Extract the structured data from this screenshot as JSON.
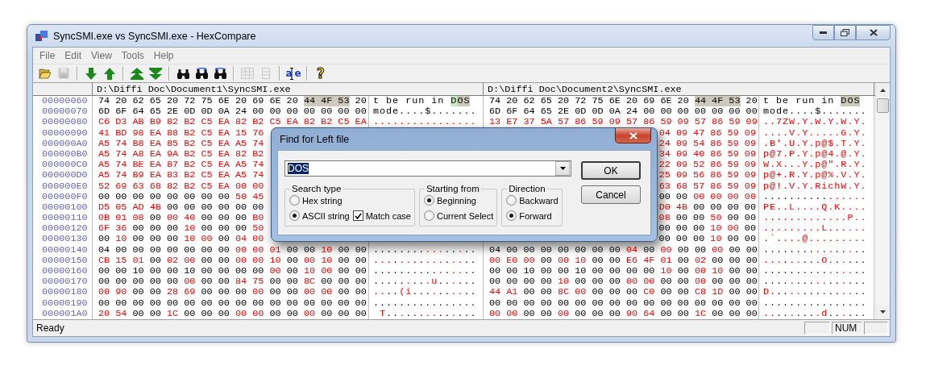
{
  "window": {
    "title": "SyncSMI.exe vs SyncSMI.exe - HexCompare"
  },
  "menu": [
    {
      "label": "File"
    },
    {
      "label": "Edit"
    },
    {
      "label": "View"
    },
    {
      "label": "Tools"
    },
    {
      "label": "Help"
    }
  ],
  "toolbar": [
    {
      "kind": "open",
      "disabled": false
    },
    {
      "kind": "save",
      "disabled": true
    },
    {
      "kind": "separator"
    },
    {
      "kind": "down",
      "disabled": false
    },
    {
      "kind": "up",
      "disabled": false
    },
    {
      "kind": "separator"
    },
    {
      "kind": "first",
      "disabled": false
    },
    {
      "kind": "last",
      "disabled": false
    },
    {
      "kind": "separator"
    },
    {
      "kind": "find",
      "disabled": false
    },
    {
      "kind": "find-next",
      "disabled": false
    },
    {
      "kind": "find-prev",
      "disabled": false
    },
    {
      "kind": "separator"
    },
    {
      "kind": "grid",
      "disabled": true
    },
    {
      "kind": "column",
      "disabled": true
    },
    {
      "kind": "separator"
    },
    {
      "kind": "text-mode",
      "label": "ae",
      "disabled": false
    },
    {
      "kind": "separator"
    },
    {
      "kind": "help",
      "label": "?",
      "disabled": false
    }
  ],
  "left_file": {
    "path": "D:\\Diffi Doc\\Document1\\SyncSMI.exe"
  },
  "right_file": {
    "path": "D:\\Diffi Doc\\Document2\\SyncSMI.exe"
  },
  "rows": [
    {
      "address": "00000060",
      "left_hex": [
        {
          "text": "74 20 62 65 20 72 75 6E 20 69 6E 20",
          "kind": "same"
        },
        {
          "text": "44 4F 53",
          "kind": "found"
        },
        {
          "text": "20",
          "kind": "same"
        }
      ],
      "left_ascii": [
        {
          "text": "t be run in ",
          "kind": "same"
        },
        {
          "text": "D",
          "kind": "cursor"
        },
        {
          "text": "OS",
          "kind": "found"
        }
      ],
      "right_hex": [
        {
          "text": "74 20 62 65 20 72 75 6E 20 69 6E 20",
          "kind": "same"
        },
        {
          "text": "44 4F 53",
          "kind": "found"
        },
        {
          "text": "20",
          "kind": "same"
        }
      ],
      "right_ascii": [
        {
          "text": "t be run in ",
          "kind": "same"
        },
        {
          "text": "DOS",
          "kind": "found"
        }
      ]
    },
    {
      "address": "00000070",
      "left_hex": [
        {
          "text": "6D 6F 64 65 2E 0D 0D 0A 24 00 00 00 00 00 00 00",
          "kind": "same"
        }
      ],
      "left_ascii": [
        {
          "text": "mode....$.......",
          "kind": "same"
        }
      ],
      "right_hex": [
        {
          "text": "6D 6F 64 65 2E 0D 0D 0A 24 00 00 00 00 00 00 00",
          "kind": "same"
        }
      ],
      "right_ascii": [
        {
          "text": "mode....$.......",
          "kind": "same"
        }
      ]
    },
    {
      "address": "00000080",
      "left_hex": [
        {
          "text": "C6 D3 AB B9 82 B2 C5 EA 82 B2 C5 EA 82 B2 C5 EA",
          "kind": "diff"
        }
      ],
      "left_ascii": [
        {
          "text": "................",
          "kind": "diff"
        }
      ],
      "right_hex": [
        {
          "text": "13 E7 37 5A 57 86 59 09 57 86 59 09 57 86 59 09",
          "kind": "diff"
        }
      ],
      "right_ascii": [
        {
          "text": "..7ZW.Y.W.Y.W.Y.",
          "kind": "diff"
        }
      ]
    },
    {
      "address": "00000090",
      "left_hex": [
        {
          "text": "41 BD 98 EA 88 B2 C5 EA 15 76",
          "kind": "diff"
        }
      ],
      "right_hex": [
        {
          "text": "04 09 47 86 59 09",
          "kind": "diff"
        }
      ],
      "right_ascii": [
        {
          "text": "....V.Y.....G.Y.",
          "kind": "diff"
        }
      ]
    },
    {
      "address": "000000A0",
      "left_hex": [
        {
          "text": "A5 74 B8 EA 85 B2 C5 EA A5 74",
          "kind": "diff"
        }
      ],
      "right_hex": [
        {
          "text": "24 09 54 86 59 09",
          "kind": "diff"
        }
      ],
      "right_ascii": [
        {
          "text": ".B'.U.Y.p@$.T.Y.",
          "kind": "diff"
        }
      ]
    },
    {
      "address": "000000B0",
      "left_hex": [
        {
          "text": "A5 74 A8 EA 9A B2 C5 EA 82 B2",
          "kind": "diff"
        }
      ],
      "right_hex": [
        {
          "text": "34 09 40 86 59 09",
          "kind": "diff"
        }
      ],
      "right_ascii": [
        {
          "text": "p@7.P.Y.p@4.@.Y.",
          "kind": "diff"
        }
      ]
    },
    {
      "address": "000000C0",
      "left_hex": [
        {
          "text": "A5 74 BE EA 87 B2 C5 EA A5 74",
          "kind": "diff"
        }
      ],
      "right_hex": [
        {
          "text": "22 09 52 86 59 09",
          "kind": "diff"
        }
      ],
      "right_ascii": [
        {
          "text": "W.X...Y.p@\".R.Y.",
          "kind": "diff"
        }
      ]
    },
    {
      "address": "000000D0",
      "left_hex": [
        {
          "text": "A5 74 B9 EA 83 B2 C5 EA A5 74",
          "kind": "diff"
        }
      ],
      "right_hex": [
        {
          "text": "25 09 56 86 59 09",
          "kind": "diff"
        }
      ],
      "right_ascii": [
        {
          "text": "p@+.R.Y.p@%.V.Y.",
          "kind": "diff"
        }
      ]
    },
    {
      "address": "000000E0",
      "left_hex": [
        {
          "text": "52 69 63 68 82 B2 C5 EA 00 00",
          "kind": "diff"
        }
      ],
      "right_hex": [
        {
          "text": "63 68 57 86 59 09",
          "kind": "diff"
        }
      ],
      "right_ascii": [
        {
          "text": "p@!.V.Y.RichW.Y.",
          "kind": "diff"
        }
      ]
    },
    {
      "address": "000000F0",
      "left_hex": [
        {
          "text": "00 00 00 00 00 00 00 00",
          "kind": "same"
        },
        {
          "text": "50 45",
          "kind": "diff"
        }
      ],
      "right_hex": [
        {
          "text": "00 00",
          "kind": "same"
        },
        {
          "text": "00 00 00 00",
          "kind": "diff"
        }
      ],
      "right_ascii": [
        {
          "text": "..........",
          "kind": "same"
        },
        {
          "text": "......",
          "kind": "diff"
        }
      ]
    },
    {
      "address": "00000100",
      "left_hex": [
        {
          "text": "D5 05 AD 4B",
          "kind": "diff"
        },
        {
          "text": "00 00 00 00 00 00",
          "kind": "same"
        }
      ],
      "right_hex": [
        {
          "text": "D0 4B",
          "kind": "diff"
        },
        {
          "text": "00 00 00 00",
          "kind": "same"
        }
      ],
      "right_ascii": [
        {
          "text": "PE..L....Q.K....",
          "kind": "diff"
        }
      ]
    },
    {
      "address": "00000110",
      "left_hex": [
        {
          "text": "0B 01 08",
          "kind": "diff"
        },
        {
          "text": "00",
          "kind": "same"
        },
        {
          "text": "00 40",
          "kind": "diff"
        },
        {
          "text": "00 00 00",
          "kind": "same"
        },
        {
          "text": "B0",
          "kind": "diff"
        }
      ],
      "right_hex": [
        {
          "text": "08",
          "kind": "diff"
        },
        {
          "text": "00 00",
          "kind": "same"
        },
        {
          "text": "50",
          "kind": "diff"
        },
        {
          "text": "00 00",
          "kind": "same"
        }
      ],
      "right_ascii": [
        {
          "text": ".............P..",
          "kind": "diff"
        }
      ]
    },
    {
      "address": "00000120",
      "left_hex": [
        {
          "text": "6F 36",
          "kind": "diff"
        },
        {
          "text": "00 00 00",
          "kind": "same"
        },
        {
          "text": "10",
          "kind": "diff"
        },
        {
          "text": "00 00 00",
          "kind": "same"
        },
        {
          "text": "50",
          "kind": "diff"
        }
      ],
      "right_hex": [
        {
          "text": "00 00 00",
          "kind": "same"
        },
        {
          "text": "10 00",
          "kind": "diff"
        },
        {
          "text": "00",
          "kind": "same"
        }
      ],
      "right_ascii": [
        {
          "text": ".........L......",
          "kind": "diff"
        }
      ]
    },
    {
      "address": "00000130",
      "left_hex": [
        {
          "text": "00",
          "kind": "same"
        },
        {
          "text": "10",
          "kind": "diff"
        },
        {
          "text": "00 00 00",
          "kind": "same"
        },
        {
          "text": "10 00",
          "kind": "diff"
        },
        {
          "text": "00",
          "kind": "same"
        },
        {
          "text": "04 00",
          "kind": "diff"
        }
      ],
      "right_hex": [
        {
          "text": "00 00 00",
          "kind": "same"
        },
        {
          "text": "10",
          "kind": "diff"
        },
        {
          "text": "00 00",
          "kind": "same"
        }
      ],
      "right_ascii": [
        {
          "text": ".`....@.........",
          "kind": "diff"
        }
      ]
    },
    {
      "address": "00000140",
      "left_hex": [
        {
          "text": "04 00 00 00 00 00 00 00",
          "kind": "same"
        },
        {
          "text": "00 00 01",
          "kind": "diff"
        },
        {
          "text": "00 00",
          "kind": "same"
        },
        {
          "text": "10",
          "kind": "diff"
        },
        {
          "text": "00 00",
          "kind": "same"
        }
      ],
      "left_ascii": [
        {
          "text": "........",
          "kind": "same"
        },
        {
          "text": "...",
          "kind": "diff"
        },
        {
          "text": "..",
          "kind": "same"
        },
        {
          "text": ".",
          "kind": "diff"
        },
        {
          "text": "..",
          "kind": "same"
        }
      ],
      "right_hex": [
        {
          "text": "04 00 00 00 00 00 00 00",
          "kind": "same"
        },
        {
          "text": "04",
          "kind": "diff"
        },
        {
          "text": "00",
          "kind": "same"
        },
        {
          "text": "00",
          "kind": "diff"
        },
        {
          "text": "00 00",
          "kind": "same"
        },
        {
          "text": "00",
          "kind": "diff"
        },
        {
          "text": "00 00",
          "kind": "same"
        }
      ],
      "right_ascii": [
        {
          "text": "........",
          "kind": "same"
        },
        {
          "text": ".",
          "kind": "diff"
        },
        {
          "text": ".",
          "kind": "same"
        },
        {
          "text": ".",
          "kind": "diff"
        },
        {
          "text": "..",
          "kind": "same"
        },
        {
          "text": ".",
          "kind": "diff"
        },
        {
          "text": "..",
          "kind": "same"
        }
      ]
    },
    {
      "address": "00000150",
      "left_hex": [
        {
          "text": "CB 15 01",
          "kind": "diff"
        },
        {
          "text": "00",
          "kind": "same"
        },
        {
          "text": "02 00",
          "kind": "diff"
        },
        {
          "text": "00 00",
          "kind": "same"
        },
        {
          "text": "00 00 10",
          "kind": "diff"
        },
        {
          "text": "00",
          "kind": "same"
        },
        {
          "text": "00 10",
          "kind": "diff"
        },
        {
          "text": "00 00",
          "kind": "same"
        }
      ],
      "left_ascii": [
        {
          "text": "...",
          "kind": "diff"
        },
        {
          "text": ".",
          "kind": "same"
        },
        {
          "text": "..",
          "kind": "diff"
        },
        {
          "text": "..",
          "kind": "same"
        },
        {
          "text": "...",
          "kind": "diff"
        },
        {
          "text": ".",
          "kind": "same"
        },
        {
          "text": "..",
          "kind": "diff"
        },
        {
          "text": "..",
          "kind": "same"
        }
      ],
      "right_hex": [
        {
          "text": "00 E0 00",
          "kind": "diff"
        },
        {
          "text": "00",
          "kind": "same"
        },
        {
          "text": "00 10",
          "kind": "diff"
        },
        {
          "text": "00 00",
          "kind": "same"
        },
        {
          "text": "E6 4F 01",
          "kind": "diff"
        },
        {
          "text": "00",
          "kind": "same"
        },
        {
          "text": "02",
          "kind": "diff"
        },
        {
          "text": "00 00 00",
          "kind": "same"
        }
      ],
      "right_ascii": [
        {
          "text": "...",
          "kind": "diff"
        },
        {
          "text": ".",
          "kind": "same"
        },
        {
          "text": "..",
          "kind": "diff"
        },
        {
          "text": "..",
          "kind": "same"
        },
        {
          "text": ".O.",
          "kind": "diff"
        },
        {
          "text": ".",
          "kind": "same"
        },
        {
          "text": ".",
          "kind": "diff"
        },
        {
          "text": "...",
          "kind": "same"
        }
      ]
    },
    {
      "address": "00000160",
      "left_hex": [
        {
          "text": "00 00 10 00 00 10 00 00 00 00",
          "kind": "same"
        },
        {
          "text": "00",
          "kind": "diff"
        },
        {
          "text": "00",
          "kind": "same"
        },
        {
          "text": "10 00",
          "kind": "diff"
        },
        {
          "text": "00 00",
          "kind": "same"
        }
      ],
      "left_ascii": [
        {
          "text": "..........",
          "kind": "same"
        },
        {
          "text": ".",
          "kind": "diff"
        },
        {
          "text": ".",
          "kind": "same"
        },
        {
          "text": "..",
          "kind": "diff"
        },
        {
          "text": "..",
          "kind": "same"
        }
      ],
      "right_hex": [
        {
          "text": "00 00 10 00 00 10 00 00 00 00",
          "kind": "same"
        },
        {
          "text": "10",
          "kind": "diff"
        },
        {
          "text": "00",
          "kind": "same"
        },
        {
          "text": "00 10",
          "kind": "diff"
        },
        {
          "text": "00 00",
          "kind": "same"
        }
      ],
      "right_ascii": [
        {
          "text": "..........",
          "kind": "same"
        },
        {
          "text": ".",
          "kind": "diff"
        },
        {
          "text": ".",
          "kind": "same"
        },
        {
          "text": "..",
          "kind": "diff"
        },
        {
          "text": "..",
          "kind": "same"
        }
      ]
    },
    {
      "address": "00000170",
      "left_hex": [
        {
          "text": "00 00 00 00 00",
          "kind": "same"
        },
        {
          "text": "00",
          "kind": "diff"
        },
        {
          "text": "00 00",
          "kind": "same"
        },
        {
          "text": "84 75",
          "kind": "diff"
        },
        {
          "text": "00 00",
          "kind": "same"
        },
        {
          "text": "8C",
          "kind": "diff"
        },
        {
          "text": "00 00 00",
          "kind": "same"
        }
      ],
      "left_ascii": [
        {
          "text": ".....",
          "kind": "same"
        },
        {
          "text": ".",
          "kind": "diff"
        },
        {
          "text": "..",
          "kind": "same"
        },
        {
          "text": ".u",
          "kind": "diff"
        },
        {
          "text": "..",
          "kind": "same"
        },
        {
          "text": ".",
          "kind": "diff"
        },
        {
          "text": "...",
          "kind": "same"
        }
      ],
      "right_hex": [
        {
          "text": "00 00 00 00",
          "kind": "same"
        },
        {
          "text": "10",
          "kind": "diff"
        },
        {
          "text": "00 00 00",
          "kind": "same"
        },
        {
          "text": "00 00",
          "kind": "diff"
        },
        {
          "text": "00 00",
          "kind": "same"
        },
        {
          "text": "00",
          "kind": "diff"
        },
        {
          "text": "00 00 00",
          "kind": "same"
        }
      ],
      "right_ascii": [
        {
          "text": "....",
          "kind": "same"
        },
        {
          "text": ".",
          "kind": "diff"
        },
        {
          "text": "...",
          "kind": "same"
        },
        {
          "text": "..",
          "kind": "diff"
        },
        {
          "text": "..",
          "kind": "same"
        },
        {
          "text": ".",
          "kind": "diff"
        },
        {
          "text": "...",
          "kind": "same"
        }
      ]
    },
    {
      "address": "00000180",
      "left_hex": [
        {
          "text": "00 90",
          "kind": "diff"
        },
        {
          "text": "00 00",
          "kind": "same"
        },
        {
          "text": "28 69",
          "kind": "diff"
        },
        {
          "text": "00 00 00",
          "kind": "same"
        },
        {
          "text": "00",
          "kind": "diff"
        },
        {
          "text": "00 00",
          "kind": "same"
        },
        {
          "text": "00 00",
          "kind": "diff"
        },
        {
          "text": "00 00",
          "kind": "same"
        }
      ],
      "left_ascii": [
        {
          "text": "..",
          "kind": "diff"
        },
        {
          "text": "..",
          "kind": "same"
        },
        {
          "text": "(i",
          "kind": "diff"
        },
        {
          "text": "...",
          "kind": "same"
        },
        {
          "text": ".",
          "kind": "diff"
        },
        {
          "text": "..",
          "kind": "same"
        },
        {
          "text": "..",
          "kind": "diff"
        },
        {
          "text": "..",
          "kind": "same"
        }
      ],
      "right_hex": [
        {
          "text": "44 A1",
          "kind": "diff"
        },
        {
          "text": "00 00",
          "kind": "same"
        },
        {
          "text": "8C 00",
          "kind": "diff"
        },
        {
          "text": "00 00 00",
          "kind": "same"
        },
        {
          "text": "C0",
          "kind": "diff"
        },
        {
          "text": "00 00",
          "kind": "same"
        },
        {
          "text": "C8 1D",
          "kind": "diff"
        },
        {
          "text": "00 00",
          "kind": "same"
        }
      ],
      "right_ascii": [
        {
          "text": "D.",
          "kind": "diff"
        },
        {
          "text": "..",
          "kind": "same"
        },
        {
          "text": "..",
          "kind": "diff"
        },
        {
          "text": "...",
          "kind": "same"
        },
        {
          "text": ".",
          "kind": "diff"
        },
        {
          "text": "..",
          "kind": "same"
        },
        {
          "text": "..",
          "kind": "diff"
        },
        {
          "text": "..",
          "kind": "same"
        }
      ]
    },
    {
      "address": "00000190",
      "left_hex": [
        {
          "text": "00 00 00 00 00 00 00 00 00 00 00 00 00 00 00 00",
          "kind": "same"
        }
      ],
      "left_ascii": [
        {
          "text": "................",
          "kind": "same"
        }
      ],
      "right_hex": [
        {
          "text": "00 00 00 00 00 00 00 00 00 00 00 00 00 00 00 00",
          "kind": "same"
        }
      ],
      "right_ascii": [
        {
          "text": "................",
          "kind": "same"
        }
      ]
    },
    {
      "address": "000001A0",
      "left_hex": [
        {
          "text": "20 54",
          "kind": "diff"
        },
        {
          "text": "00 00",
          "kind": "same"
        },
        {
          "text": "1C",
          "kind": "diff"
        },
        {
          "text": "00 00 00",
          "kind": "same"
        },
        {
          "text": "00 00",
          "kind": "diff"
        },
        {
          "text": "00 00",
          "kind": "same"
        },
        {
          "text": "00",
          "kind": "diff"
        },
        {
          "text": "00 00 00",
          "kind": "same"
        }
      ],
      "left_ascii": [
        {
          "text": " T",
          "kind": "diff"
        },
        {
          "text": "..",
          "kind": "same"
        },
        {
          "text": ".",
          "kind": "diff"
        },
        {
          "text": "...",
          "kind": "same"
        },
        {
          "text": "..",
          "kind": "diff"
        },
        {
          "text": "..",
          "kind": "same"
        },
        {
          "text": ".",
          "kind": "diff"
        },
        {
          "text": "...",
          "kind": "same"
        }
      ],
      "right_hex": [
        {
          "text": "00 00",
          "kind": "diff"
        },
        {
          "text": "00 00",
          "kind": "same"
        },
        {
          "text": "00",
          "kind": "diff"
        },
        {
          "text": "00 00 00",
          "kind": "same"
        },
        {
          "text": "90 64",
          "kind": "diff"
        },
        {
          "text": "00 00",
          "kind": "same"
        },
        {
          "text": "1C",
          "kind": "diff"
        },
        {
          "text": "00 00 00",
          "kind": "same"
        }
      ],
      "right_ascii": [
        {
          "text": "..",
          "kind": "diff"
        },
        {
          "text": "..",
          "kind": "same"
        },
        {
          "text": ".",
          "kind": "diff"
        },
        {
          "text": "...",
          "kind": "same"
        },
        {
          "text": ".d",
          "kind": "diff"
        },
        {
          "text": "..",
          "kind": "same"
        },
        {
          "text": ".",
          "kind": "diff"
        },
        {
          "text": "...",
          "kind": "same"
        }
      ]
    }
  ],
  "find_dialog": {
    "title": "Find for Left file",
    "search": {
      "value": "DOS"
    },
    "groups": [
      {
        "title": "Search type",
        "lines": [
          [
            {
              "kind": "radio",
              "label": "Hex string",
              "selected": false
            }
          ],
          [
            {
              "kind": "radio",
              "label": "ASCII string",
              "selected": true
            },
            {
              "kind": "checkbox",
              "label": "Match case",
              "checked": true
            }
          ]
        ]
      },
      {
        "title": "Starting from",
        "lines": [
          [
            {
              "kind": "radio",
              "label": "Beginning",
              "selected": true
            }
          ],
          [
            {
              "kind": "radio",
              "label": "Current Select",
              "selected": false
            }
          ]
        ]
      },
      {
        "title": "Direction",
        "lines": [
          [
            {
              "kind": "radio",
              "label": "Backward",
              "selected": false
            }
          ],
          [
            {
              "kind": "radio",
              "label": "Forward",
              "selected": true
            }
          ]
        ]
      }
    ],
    "buttons": [
      {
        "label": "OK",
        "default": true
      },
      {
        "label": "Cancel",
        "default": false
      }
    ]
  },
  "status_bar": {
    "text": "Ready",
    "indicator": "NUM"
  }
}
